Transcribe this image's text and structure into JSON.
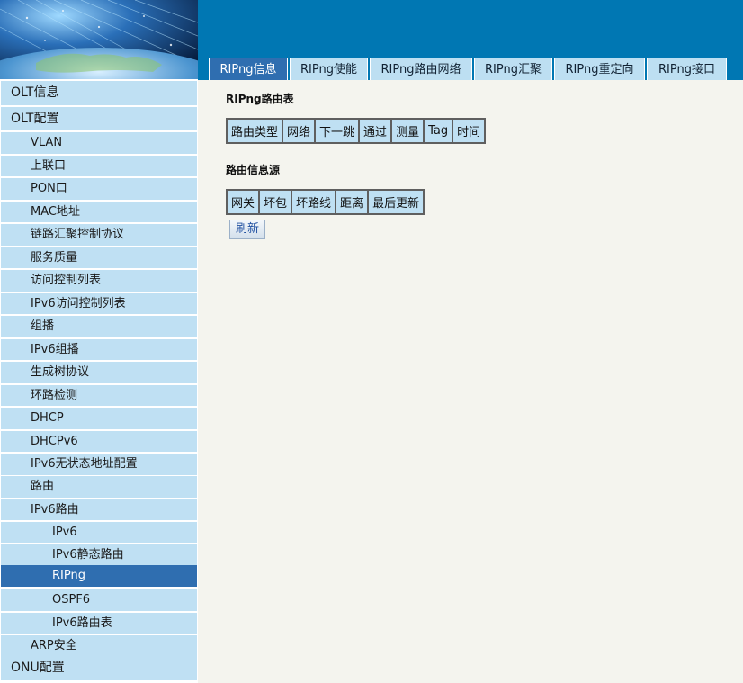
{
  "header": {
    "logo_icon": "globe-fiber-optic-banner"
  },
  "tabs": [
    {
      "label": "RIPng信息",
      "active": true
    },
    {
      "label": "RIPng使能",
      "active": false
    },
    {
      "label": "RIPng路由网络",
      "active": false
    },
    {
      "label": "RIPng汇聚",
      "active": false
    },
    {
      "label": "RIPng重定向",
      "active": false
    },
    {
      "label": "RIPng接口",
      "active": false
    }
  ],
  "sidebar": {
    "items": [
      {
        "label": "OLT信息",
        "level": 0
      },
      {
        "label": "OLT配置",
        "level": 0
      },
      {
        "label": "VLAN",
        "level": 1
      },
      {
        "label": "上联口",
        "level": 1
      },
      {
        "label": "PON口",
        "level": 1
      },
      {
        "label": "MAC地址",
        "level": 1
      },
      {
        "label": "链路汇聚控制协议",
        "level": 1
      },
      {
        "label": "服务质量",
        "level": 1
      },
      {
        "label": "访问控制列表",
        "level": 1
      },
      {
        "label": "IPv6访问控制列表",
        "level": 1
      },
      {
        "label": "组播",
        "level": 1
      },
      {
        "label": "IPv6组播",
        "level": 1
      },
      {
        "label": "生成树协议",
        "level": 1
      },
      {
        "label": "环路检测",
        "level": 1
      },
      {
        "label": "DHCP",
        "level": 1
      },
      {
        "label": "DHCPv6",
        "level": 1
      },
      {
        "label": "IPv6无状态地址配置",
        "level": 1
      },
      {
        "label": "路由",
        "level": 1
      },
      {
        "label": "IPv6路由",
        "level": 1
      },
      {
        "label": "IPv6",
        "level": 2
      },
      {
        "label": "IPv6静态路由",
        "level": 2
      },
      {
        "label": "RIPng",
        "level": 2,
        "active": true
      },
      {
        "label": "OSPF6",
        "level": 2
      },
      {
        "label": "IPv6路由表",
        "level": 2
      },
      {
        "label": "ARP安全",
        "level": 1
      },
      {
        "label": "ONU配置",
        "level": 0
      }
    ]
  },
  "main": {
    "route_table": {
      "title": "RIPng路由表",
      "columns": [
        "路由类型",
        "网络",
        "下一跳",
        "通过",
        "测量",
        "Tag",
        "时间"
      ]
    },
    "route_source": {
      "title": "路由信息源",
      "columns": [
        "网关",
        "坏包",
        "坏路线",
        "距离",
        "最后更新"
      ]
    },
    "refresh_label": "刷新"
  },
  "colors": {
    "banner": "#0077b3",
    "nav_item": "#bfe0f3",
    "nav_active": "#2f6eb0",
    "content_bg": "#f4f4ee"
  }
}
